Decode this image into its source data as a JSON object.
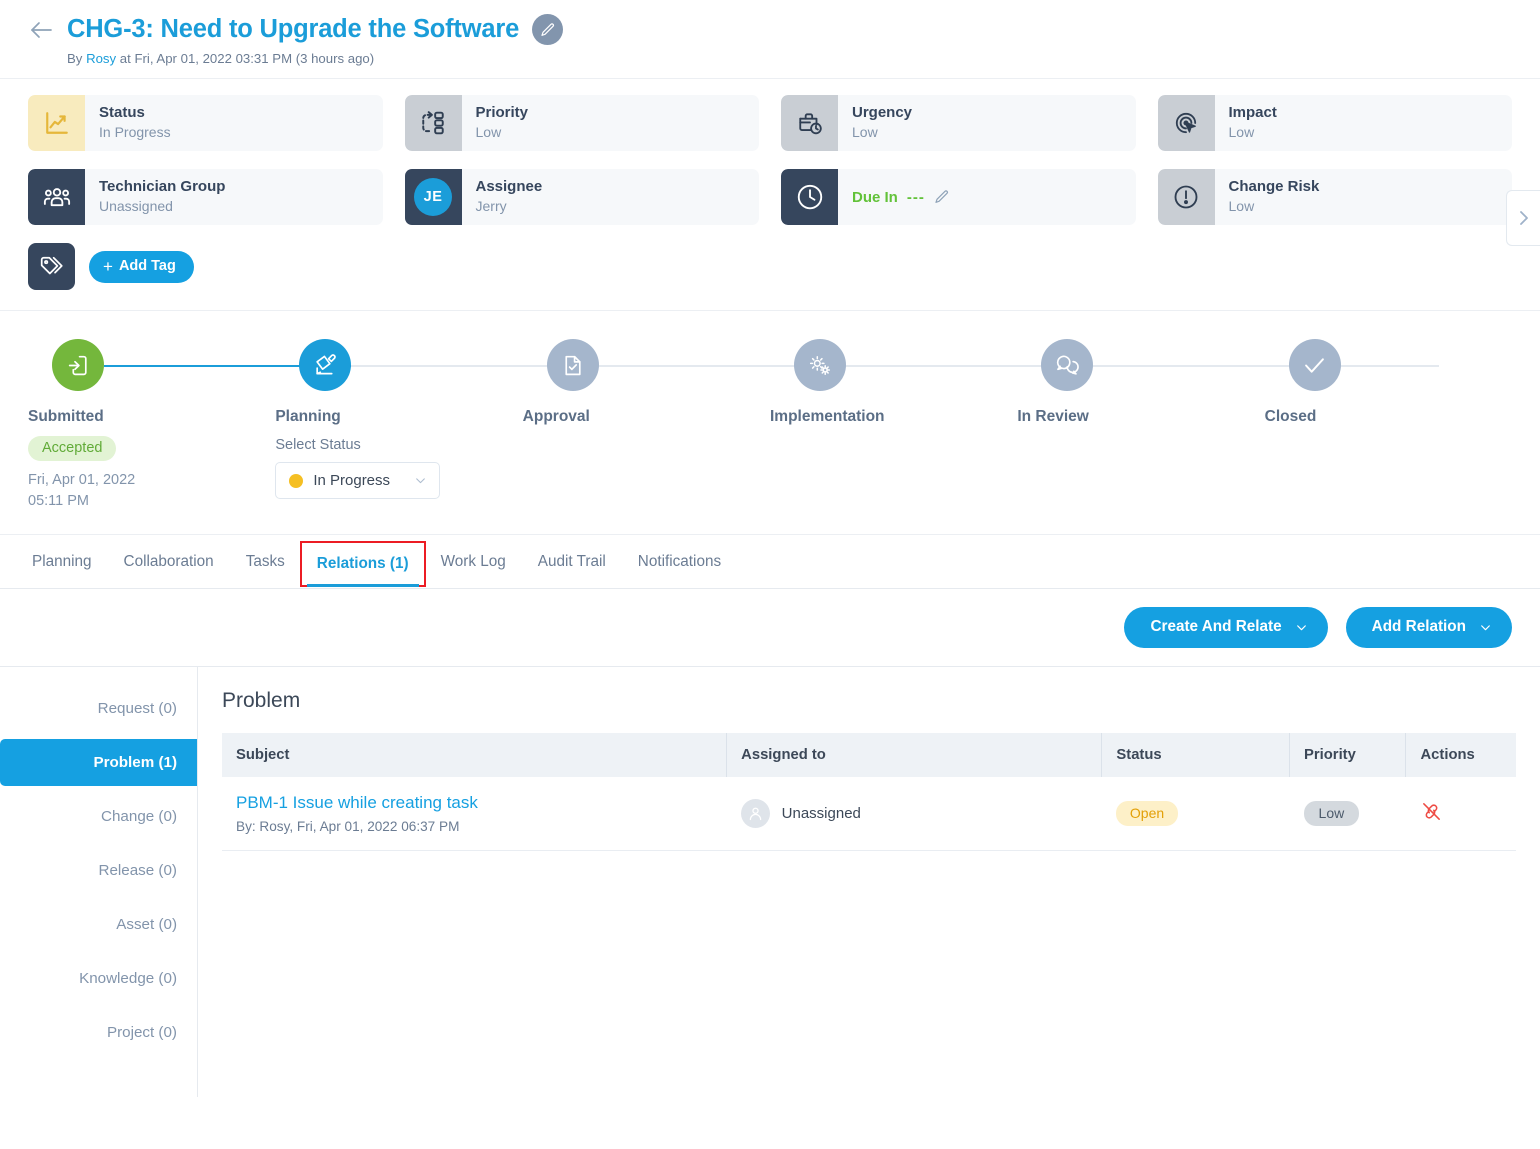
{
  "header": {
    "back_icon": "arrow-left-icon",
    "title": "CHG-3: Need to Upgrade the Software",
    "edit_icon": "pencil-icon",
    "byline_prefix": "By",
    "byline_author": "Rosy",
    "byline_suffix": "at Fri, Apr 01, 2022 03:31 PM (3 hours ago)"
  },
  "properties": [
    {
      "label": "Status",
      "value": "In Progress",
      "icon": "line-chart-icon",
      "tile": "yellow"
    },
    {
      "label": "Priority",
      "value": "Low",
      "icon": "priority-flow-icon",
      "tile": "grey"
    },
    {
      "label": "Urgency",
      "value": "Low",
      "icon": "briefcase-clock-icon",
      "tile": "grey"
    },
    {
      "label": "Impact",
      "value": "Low",
      "icon": "target-cursor-icon",
      "tile": "grey"
    },
    {
      "label": "Technician Group",
      "value": "Unassigned",
      "icon": "people-group-icon",
      "tile": "navy"
    },
    {
      "label": "Assignee",
      "value": "Jerry",
      "icon": "avatar-initials",
      "avatar_initials": "JE",
      "tile": "navy"
    },
    {
      "label": "Due In",
      "value": "---",
      "icon": "clock-icon",
      "tile": "navy",
      "variant": "duein",
      "edit_icon": "pencil-icon"
    },
    {
      "label": "Change Risk",
      "value": "Low",
      "icon": "exclamation-circle-icon",
      "tile": "grey"
    }
  ],
  "scroll_next_icon": "chevron-right-icon",
  "tags": {
    "icon": "tag-icon",
    "add_label": "Add Tag",
    "plus": "+"
  },
  "stepper": {
    "steps": [
      {
        "label": "Submitted",
        "icon": "document-in-icon",
        "state": "green",
        "badge": "Accepted",
        "date": "Fri, Apr 01, 2022 05:11 PM"
      },
      {
        "label": "Planning",
        "icon": "pencil-board-icon",
        "state": "blue",
        "select_label": "Select Status",
        "select_value": "In Progress",
        "select_dot_color": "#f5bf23",
        "chevron": "chevron-down-icon"
      },
      {
        "label": "Approval",
        "icon": "document-check-icon",
        "state": "grey"
      },
      {
        "label": "Implementation",
        "icon": "gears-icon",
        "state": "grey"
      },
      {
        "label": "In Review",
        "icon": "chat-bubbles-icon",
        "state": "grey"
      },
      {
        "label": "Closed",
        "icon": "check-icon",
        "state": "grey"
      }
    ]
  },
  "tabs": [
    {
      "label": "Planning",
      "active": false
    },
    {
      "label": "Collaboration",
      "active": false
    },
    {
      "label": "Tasks",
      "active": false
    },
    {
      "label": "Relations (1)",
      "active": true,
      "highlighted": true
    },
    {
      "label": "Work Log",
      "active": false
    },
    {
      "label": "Audit Trail",
      "active": false
    },
    {
      "label": "Notifications",
      "active": false
    }
  ],
  "actions": {
    "create_and_relate": "Create And Relate",
    "add_relation": "Add Relation",
    "chevron": "chevron-down-icon"
  },
  "relations": {
    "sidebar": [
      {
        "label": "Request (0)",
        "active": false
      },
      {
        "label": "Problem (1)",
        "active": true
      },
      {
        "label": "Change (0)",
        "active": false
      },
      {
        "label": "Release (0)",
        "active": false
      },
      {
        "label": "Asset (0)",
        "active": false
      },
      {
        "label": "Knowledge (0)",
        "active": false
      },
      {
        "label": "Project (0)",
        "active": false
      }
    ],
    "heading": "Problem",
    "columns": [
      "Subject",
      "Assigned to",
      "Status",
      "Priority",
      "Actions"
    ],
    "rows": [
      {
        "subject": "PBM-1 Issue while creating task",
        "subject_sub": "By: Rosy, Fri, Apr 01, 2022 06:37 PM",
        "assigned_to": "Unassigned",
        "assigned_avatar_icon": "user-avatar-icon",
        "status": "Open",
        "priority": "Low",
        "action_icon": "unlink-icon"
      }
    ]
  },
  "colors": {
    "brand_blue": "#15a0e1",
    "navy": "#36465d",
    "green": "#74b73c",
    "grey_step": "#a5b6cc",
    "status_yellow": "#f5bf23",
    "danger_red": "#ee4b44",
    "highlight_red": "#ec1c24"
  }
}
